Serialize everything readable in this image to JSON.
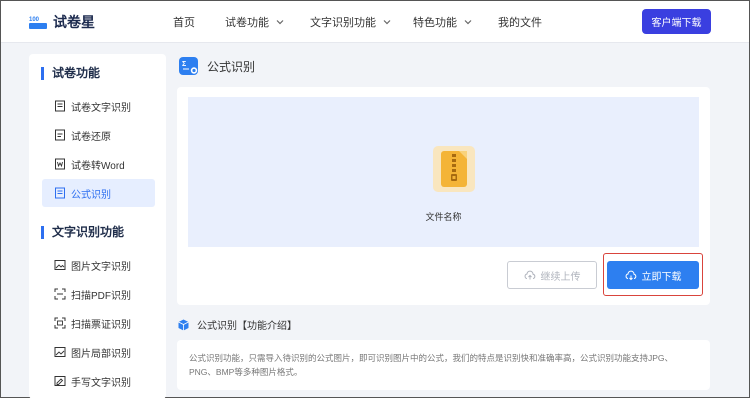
{
  "header": {
    "brand": "试卷星",
    "nav": [
      {
        "label": "首页",
        "dropdown": false
      },
      {
        "label": "试卷功能",
        "dropdown": true
      },
      {
        "label": "文字识别功能",
        "dropdown": true
      },
      {
        "label": "特色功能",
        "dropdown": true
      },
      {
        "label": "我的文件",
        "dropdown": false
      }
    ],
    "download_label": "客户端下载"
  },
  "sidebar": {
    "section1_title": "试卷功能",
    "section1_items": [
      {
        "label": "试卷文字识别",
        "icon": "document-text-icon",
        "active": false
      },
      {
        "label": "试卷还原",
        "icon": "document-restore-icon",
        "active": false
      },
      {
        "label": "试卷转Word",
        "icon": "word-convert-icon",
        "active": false
      },
      {
        "label": "公式识别",
        "icon": "formula-icon",
        "active": true
      }
    ],
    "section2_title": "文字识别功能",
    "section2_items": [
      {
        "label": "图片文字识别",
        "icon": "image-text-icon"
      },
      {
        "label": "扫描PDF识别",
        "icon": "pdf-scan-icon"
      },
      {
        "label": "扫描票证识别",
        "icon": "ticket-scan-icon"
      },
      {
        "label": "图片局部识别",
        "icon": "image-crop-icon"
      },
      {
        "label": "手写文字识别",
        "icon": "handwriting-icon"
      }
    ]
  },
  "main": {
    "page_title": "公式识别",
    "file_name": "文件名称",
    "continue_label": "继续上传",
    "download_now_label": "立即下载",
    "intro_title": "公式识别【功能介绍】",
    "intro_text": "公式识别功能，只需导入待识别的公式图片，即可识别图片中的公式，我们的特点是识别快和准确率高，公式识别功能支持JPG、PNG、BMP等多种图片格式。"
  },
  "colors": {
    "accent": "#2d7ff0",
    "header_button": "#3a3fe0",
    "drop_zone": "#e9effd",
    "highlight": "#d9443c"
  }
}
